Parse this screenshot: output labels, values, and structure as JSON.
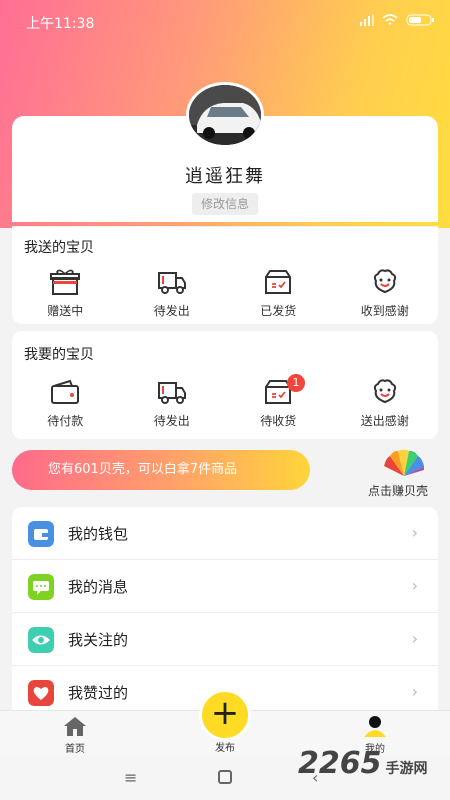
{
  "status": {
    "time": "上午11:38"
  },
  "profile": {
    "username": "逍遥狂舞",
    "edit_label": "修改信息"
  },
  "sent": {
    "title": "我送的宝贝",
    "items": [
      {
        "label": "赠送中",
        "icon": "gift-icon"
      },
      {
        "label": "待发出",
        "icon": "truck-icon"
      },
      {
        "label": "已发货",
        "icon": "shipped-box-icon"
      },
      {
        "label": "收到感谢",
        "icon": "smile-flower-icon"
      }
    ]
  },
  "wanted": {
    "title": "我要的宝贝",
    "items": [
      {
        "label": "待付款",
        "icon": "wallet-icon"
      },
      {
        "label": "待发出",
        "icon": "truck-icon"
      },
      {
        "label": "待收货",
        "icon": "receive-box-icon",
        "badge": "1"
      },
      {
        "label": "送出感谢",
        "icon": "smile-flower-icon"
      }
    ]
  },
  "shells": {
    "banner_text": "您有601贝壳，可以白拿7件商品",
    "earn_label": "点击赚贝壳"
  },
  "menu": [
    {
      "label": "我的钱包",
      "icon": "wallet-icon",
      "color": "#4a90e2"
    },
    {
      "label": "我的消息",
      "icon": "message-icon",
      "color": "#7ed321"
    },
    {
      "label": "我关注的",
      "icon": "eye-icon",
      "color": "#3ecfb2"
    },
    {
      "label": "我赞过的",
      "icon": "heart-icon",
      "color": "#e8453c"
    }
  ],
  "tabs": {
    "home": "首页",
    "publish": "发布",
    "mine": "我的"
  },
  "watermark": {
    "text": "2265",
    "suffix": "手游网"
  },
  "colors": {
    "accent": "#ffdb26",
    "badge": "#f1453d"
  }
}
